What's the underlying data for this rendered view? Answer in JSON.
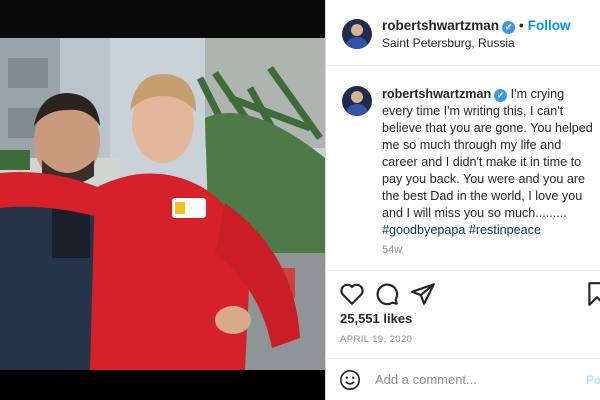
{
  "header": {
    "username": "robertshwartzman",
    "verified_mark": "✔",
    "separator": "•",
    "follow_label": "Follow",
    "location": "Saint Petersburg, Russia"
  },
  "caption": {
    "username": "robertshwartzman",
    "text": "I'm crying every time I'm writing this, I can't believe that you are gone. You helped me so much through my life and career and I didn't make it in time to pay you back. You were and you are the best Dad in the world, I love you and I will miss you so much.........",
    "hashtag_1": "#goodbyepapa",
    "hashtag_2": "#restinpeace",
    "age": "54w"
  },
  "stats": {
    "likes": "25,551 likes",
    "date": "APRIL 19, 2020"
  },
  "comment": {
    "placeholder": "Add a comment...",
    "post_label": "Post"
  },
  "icons": {
    "like": "heart-icon",
    "comment": "comment-icon",
    "share": "share-icon",
    "save": "bookmark-icon",
    "emoji": "emoji-icon"
  },
  "colors": {
    "accent": "#0095f6",
    "verified": "#3897f0",
    "hashtag": "#00376b",
    "jacket_red": "#d6212b"
  }
}
